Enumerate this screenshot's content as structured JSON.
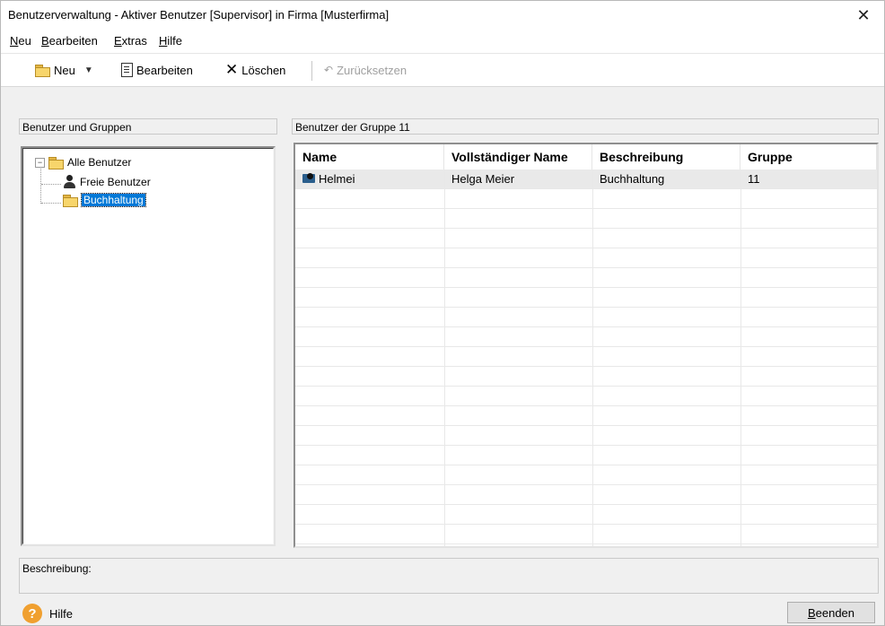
{
  "window": {
    "title": "Benutzerverwaltung - Aktiver Benutzer [Supervisor] in Firma [Musterfirma]",
    "close_glyph": "✕"
  },
  "menu": [
    "Neu",
    "Bearbeiten",
    "Extras",
    "Hilfe"
  ],
  "toolbar": {
    "new_label": "Neu",
    "edit_label": "Bearbeiten",
    "delete_label": "Löschen",
    "reset_label": "Zurücksetzen"
  },
  "left_pane": {
    "header": "Benutzer und Gruppen",
    "tree": {
      "root": "Alle Benutzer",
      "children": [
        "Freie Benutzer",
        "Buchhaltung"
      ],
      "selected": "Buchhaltung"
    }
  },
  "right_pane": {
    "header": "Benutzer der Gruppe 11",
    "columns": [
      "Name",
      "Vollständiger Name",
      "Beschreibung",
      "Gruppe"
    ],
    "rows": [
      [
        "Helmei",
        "Helga Meier",
        "Buchhaltung",
        "11"
      ]
    ]
  },
  "description": {
    "label": "Beschreibung:"
  },
  "footer": {
    "help_label": "Hilfe",
    "help_glyph": "?",
    "close_button": "Beenden"
  }
}
